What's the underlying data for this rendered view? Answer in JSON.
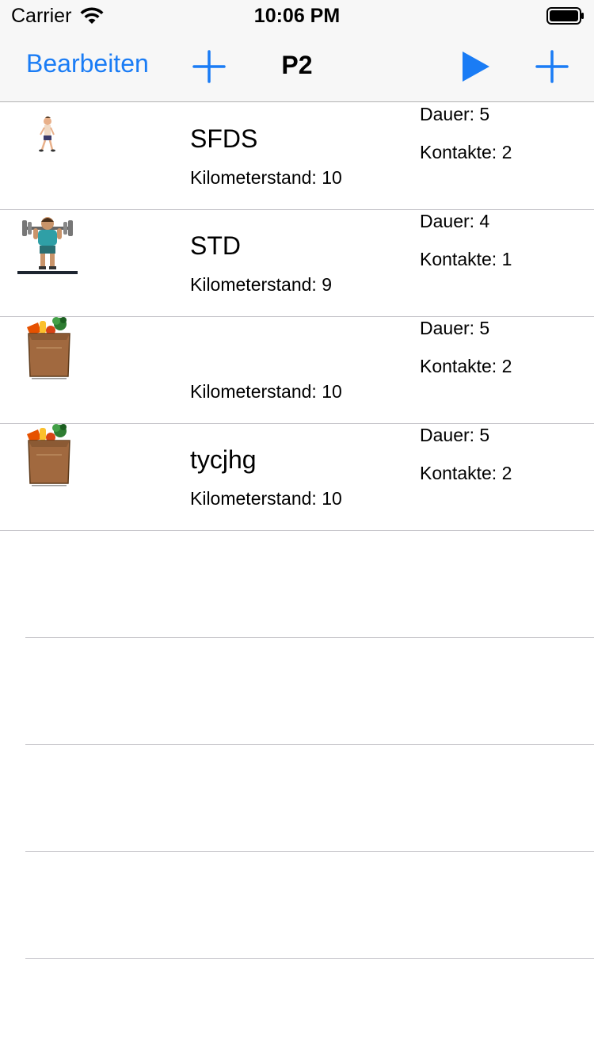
{
  "status_bar": {
    "carrier": "Carrier",
    "time": "10:06 PM",
    "wifi_icon": "wifi-icon",
    "battery_icon": "battery-icon"
  },
  "nav": {
    "edit_label": "Bearbeiten",
    "title": "P2",
    "left_add_icon": "plus-icon",
    "play_icon": "play-icon",
    "right_add_icon": "plus-icon",
    "accent_color": "#1a7cf5"
  },
  "rows": [
    {
      "image_icon": "running-person-icon",
      "name": "SFDS",
      "km": "Kilometerstand: 10",
      "dauer": "Dauer: 5",
      "kontakte": "Kontakte: 2"
    },
    {
      "image_icon": "weightlifter-icon",
      "name": "STD",
      "km": "Kilometerstand: 9",
      "dauer": "Dauer: 4",
      "kontakte": "Kontakte: 1"
    },
    {
      "image_icon": "grocery-bag-icon",
      "name": "",
      "km": "Kilometerstand: 10",
      "dauer": "Dauer: 5",
      "kontakte": "Kontakte: 2"
    },
    {
      "image_icon": "grocery-bag-icon",
      "name": "tycjhg",
      "km": "Kilometerstand: 10",
      "dauer": "Dauer: 5",
      "kontakte": "Kontakte: 2"
    }
  ]
}
